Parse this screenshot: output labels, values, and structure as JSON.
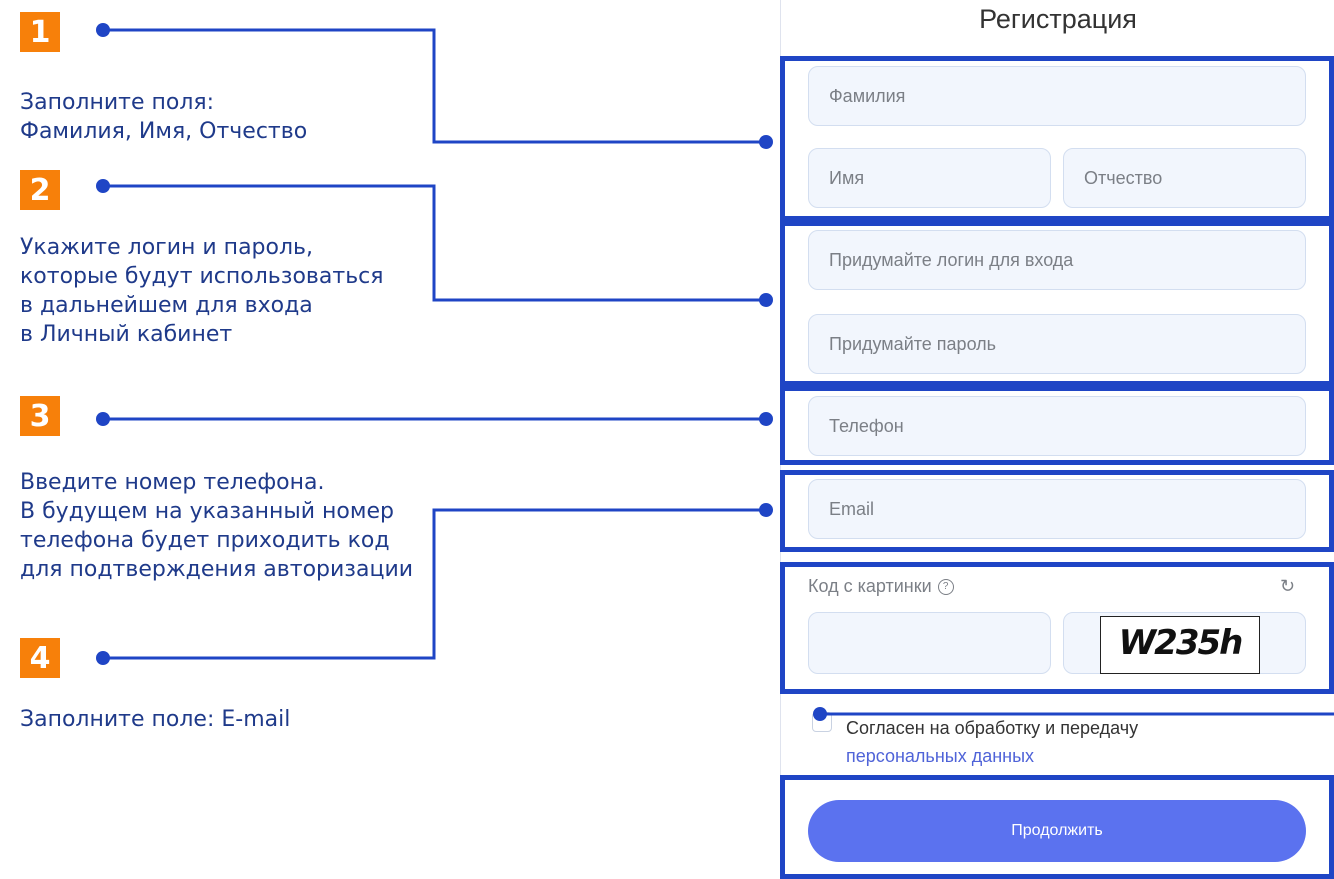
{
  "steps": [
    {
      "number": "1",
      "lines": [
        "Заполните поля:",
        "Фамилия, Имя, Отчество"
      ]
    },
    {
      "number": "2",
      "lines": [
        "Укажите логин и пароль,",
        "которые будут использоваться",
        "в дальнейшем для входа",
        "в Личный кабинет"
      ]
    },
    {
      "number": "3",
      "lines": [
        "Введите номер телефона.",
        "В будущем на указанный номер",
        "телефона будет приходить код",
        "для  подтверждения авторизации"
      ]
    },
    {
      "number": "4",
      "lines": [
        "Заполните поле: E-mail"
      ]
    }
  ],
  "form": {
    "title": "Регистрация",
    "surname_placeholder": "Фамилия",
    "name_placeholder": "Имя",
    "patronymic_placeholder": "Отчество",
    "login_placeholder": "Придумайте логин для входа",
    "password_placeholder": "Придумайте пароль",
    "phone_placeholder": "Телефон",
    "email_placeholder": "Email",
    "captcha_label": "Код с картинки",
    "captcha_help_icon": "?",
    "captcha_refresh_icon": "↻",
    "captcha_code": "W235h",
    "consent_text": "Согласен на обработку и передачу",
    "consent_link": "персональных данных",
    "submit_label": "Продолжить"
  },
  "colors": {
    "accent": "#f7800a",
    "callout": "#1f45c5",
    "button": "#5b72ef",
    "field_bg": "#f2f6fd"
  }
}
